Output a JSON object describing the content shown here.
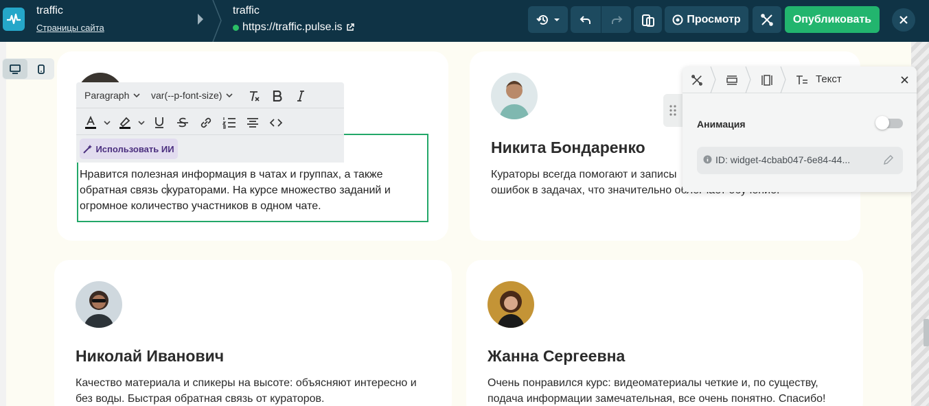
{
  "topbar": {
    "site_title": "traffic",
    "site_link": "Страницы сайта",
    "page_title": "traffic",
    "page_url": "https://traffic.pulse.is",
    "preview_label": "Просмотр",
    "publish_label": "Опубликовать",
    "accent": "#22b56e",
    "background": "#0f3345"
  },
  "editor": {
    "block_format": "Paragraph",
    "font_size": "var(--p-font-size)",
    "ai_button": "Использовать ИИ",
    "text_before_caret": "Нравится полезная информация в чатах и группах, а также обратная связь с",
    "text_after_caret": "кураторами. На курсе множество заданий и огромное количество участников в одном чате."
  },
  "cards": [
    {
      "name": "Никита Бондаренко",
      "text": "Кураторы всегда помогают и записы",
      "text_line2": "ошибок в задачах, что значительно облегчает обучение."
    },
    {
      "name": "Николай Иванович",
      "text": "Качество материала и спикеры на высоте: объясняют интересно и без воды. Быстрая обратная связь от кураторов."
    },
    {
      "name": "Жанна Сергеевна",
      "text": "Очень понравился курс: видеоматериалы четкие и, по существу, подача информации замечательная, все очень понятно. Спасибо!"
    }
  ],
  "panel": {
    "title": "Текст",
    "animation_label": "Анимация",
    "widget_id": "ID: widget-4cbab047-6e84-44..."
  }
}
